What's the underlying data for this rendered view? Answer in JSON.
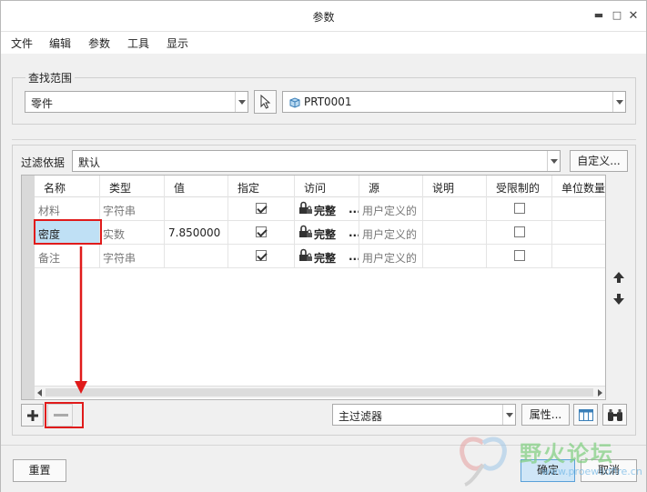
{
  "window": {
    "title": "参数"
  },
  "menu": [
    "文件",
    "编辑",
    "参数",
    "工具",
    "显示"
  ],
  "search_scope": {
    "legend": "查找范围",
    "scope_value": "零件",
    "model_value": "PRT0001"
  },
  "filter": {
    "label": "过滤依据",
    "value": "默认",
    "customize_label": "自定义..."
  },
  "table": {
    "columns": [
      "名称",
      "类型",
      "值",
      "指定",
      "访问",
      "源",
      "说明",
      "受限制的",
      "单位数量"
    ],
    "rows": [
      {
        "name": "材料",
        "type": "字符串",
        "value": "",
        "designate": true,
        "access": "完整",
        "source": "用户定义的",
        "desc": "",
        "restricted": false
      },
      {
        "name": "密度",
        "type": "实数",
        "value": "7.850000",
        "designate": true,
        "access": "完整",
        "source": "用户定义的",
        "desc": "",
        "restricted": false
      },
      {
        "name": "备注",
        "type": "字符串",
        "value": "",
        "designate": true,
        "access": "完整",
        "source": "用户定义的",
        "desc": "",
        "restricted": false
      }
    ],
    "access_more": "..."
  },
  "bottom_toolbar": {
    "filter_value": "主过滤器",
    "properties_label": "属性..."
  },
  "footer": {
    "reset_label": "重置",
    "ok_label": "确定",
    "cancel_label": "取消"
  },
  "watermark": {
    "text": "野火论坛",
    "url": "www.proewildfire.cn"
  },
  "colors": {
    "annotation_red": "#e01b1b",
    "selected_cell": "#bfe0f5"
  }
}
